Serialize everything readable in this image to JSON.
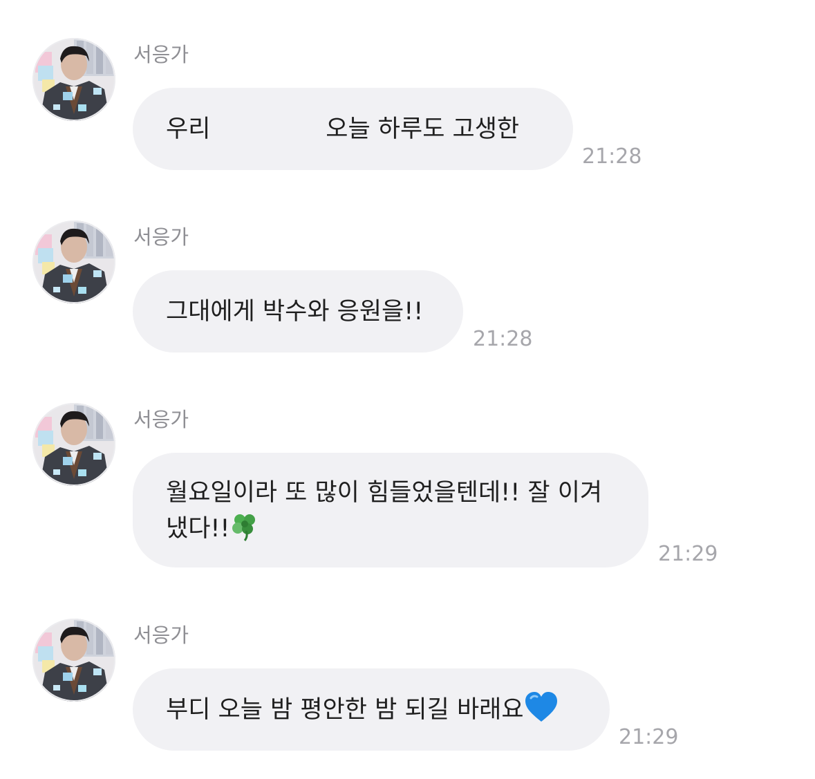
{
  "chat": {
    "messages": [
      {
        "sender": "서응가",
        "text": "우리               오늘 하루도 고생한",
        "time": "21:28"
      },
      {
        "sender": "서응가",
        "text": "그대에게 박수와 응원을!!",
        "time": "21:28"
      },
      {
        "sender": "서응가",
        "line1": "월요일이라 또 많이 힘들었을텐데!! 잘 이겨",
        "line2": "냈다!!",
        "emoji": "four-leaf-clover",
        "time": "21:29"
      },
      {
        "sender": "서응가",
        "text": "부디 오늘 밤 평안한 밤 되길 바래요",
        "emoji": "blue-heart",
        "time": "21:29"
      }
    ]
  },
  "colors": {
    "bubble_bg": "#f1f1f4",
    "name_text": "#8e8e93",
    "time_text": "#a6a6ab",
    "message_text": "#1f1f1f"
  }
}
